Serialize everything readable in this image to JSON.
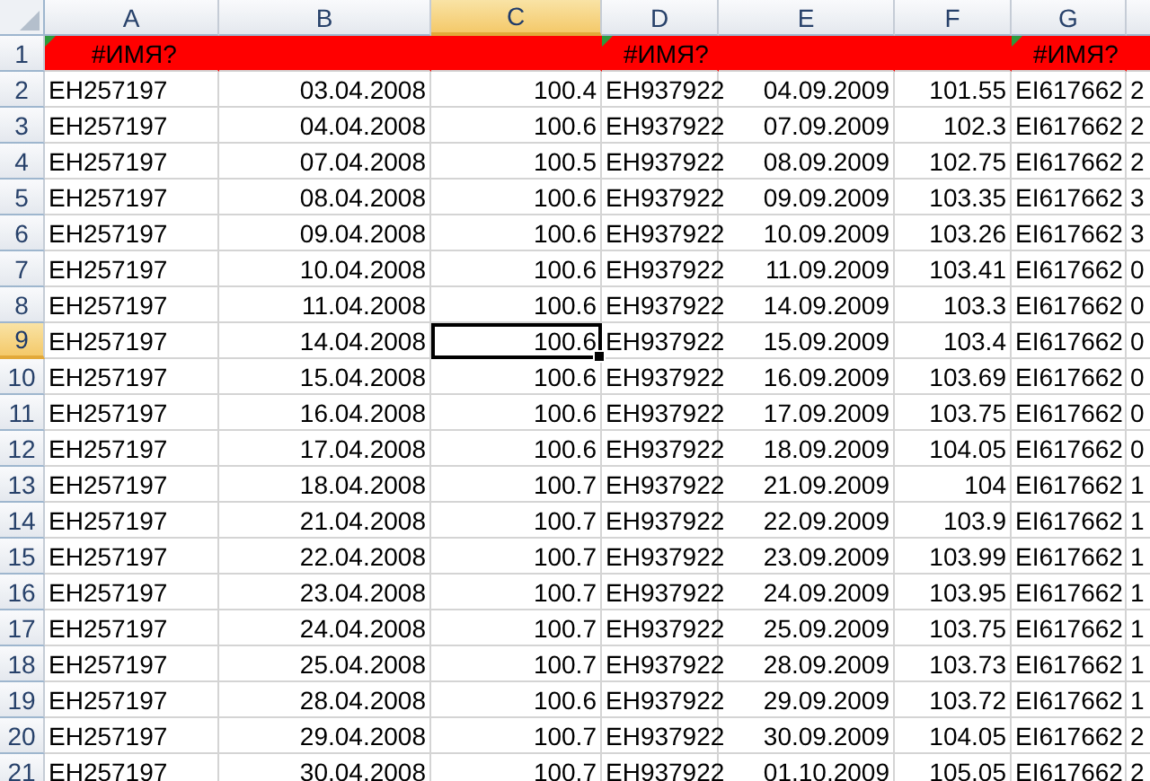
{
  "columns": [
    {
      "label": "A",
      "kind": "text",
      "selected": false
    },
    {
      "label": "B",
      "kind": "number",
      "selected": false
    },
    {
      "label": "C",
      "kind": "number",
      "selected": true
    },
    {
      "label": "D",
      "kind": "text",
      "selected": false
    },
    {
      "label": "E",
      "kind": "number",
      "selected": false
    },
    {
      "label": "F",
      "kind": "number",
      "selected": false
    },
    {
      "label": "G",
      "kind": "text",
      "selected": false
    },
    {
      "kind": "text",
      "selected": false
    }
  ],
  "error_row": {
    "number": "1",
    "selected": false,
    "cells": [
      "#ИМЯ?",
      null,
      null,
      "#ИМЯ?",
      null,
      null,
      "#ИМЯ?",
      null
    ]
  },
  "rows": [
    {
      "number": "2",
      "selected": false,
      "cells": [
        "EH257197",
        "03.04.2008",
        "100.4",
        "EH937922",
        "04.09.2009",
        "101.55",
        "EI617662",
        "2"
      ]
    },
    {
      "number": "3",
      "selected": false,
      "cells": [
        "EH257197",
        "04.04.2008",
        "100.6",
        "EH937922",
        "07.09.2009",
        "102.3",
        "EI617662",
        "2"
      ]
    },
    {
      "number": "4",
      "selected": false,
      "cells": [
        "EH257197",
        "07.04.2008",
        "100.5",
        "EH937922",
        "08.09.2009",
        "102.75",
        "EI617662",
        "2"
      ]
    },
    {
      "number": "5",
      "selected": false,
      "cells": [
        "EH257197",
        "08.04.2008",
        "100.6",
        "EH937922",
        "09.09.2009",
        "103.35",
        "EI617662",
        "3"
      ]
    },
    {
      "number": "6",
      "selected": false,
      "cells": [
        "EH257197",
        "09.04.2008",
        "100.6",
        "EH937922",
        "10.09.2009",
        "103.26",
        "EI617662",
        "3"
      ]
    },
    {
      "number": "7",
      "selected": false,
      "cells": [
        "EH257197",
        "10.04.2008",
        "100.6",
        "EH937922",
        "11.09.2009",
        "103.41",
        "EI617662",
        "0"
      ]
    },
    {
      "number": "8",
      "selected": false,
      "cells": [
        "EH257197",
        "11.04.2008",
        "100.6",
        "EH937922",
        "14.09.2009",
        "103.3",
        "EI617662",
        "0"
      ]
    },
    {
      "number": "9",
      "selected": true,
      "cells": [
        "EH257197",
        "14.04.2008",
        "100.6",
        "EH937922",
        "15.09.2009",
        "103.4",
        "EI617662",
        "0"
      ]
    },
    {
      "number": "10",
      "selected": false,
      "cells": [
        "EH257197",
        "15.04.2008",
        "100.6",
        "EH937922",
        "16.09.2009",
        "103.69",
        "EI617662",
        "0"
      ]
    },
    {
      "number": "11",
      "selected": false,
      "cells": [
        "EH257197",
        "16.04.2008",
        "100.6",
        "EH937922",
        "17.09.2009",
        "103.75",
        "EI617662",
        "0"
      ]
    },
    {
      "number": "12",
      "selected": false,
      "cells": [
        "EH257197",
        "17.04.2008",
        "100.6",
        "EH937922",
        "18.09.2009",
        "104.05",
        "EI617662",
        "0"
      ]
    },
    {
      "number": "13",
      "selected": false,
      "cells": [
        "EH257197",
        "18.04.2008",
        "100.7",
        "EH937922",
        "21.09.2009",
        "104",
        "EI617662",
        "1"
      ]
    },
    {
      "number": "14",
      "selected": false,
      "cells": [
        "EH257197",
        "21.04.2008",
        "100.7",
        "EH937922",
        "22.09.2009",
        "103.9",
        "EI617662",
        "1"
      ]
    },
    {
      "number": "15",
      "selected": false,
      "cells": [
        "EH257197",
        "22.04.2008",
        "100.7",
        "EH937922",
        "23.09.2009",
        "103.99",
        "EI617662",
        "1"
      ]
    },
    {
      "number": "16",
      "selected": false,
      "cells": [
        "EH257197",
        "23.04.2008",
        "100.7",
        "EH937922",
        "24.09.2009",
        "103.95",
        "EI617662",
        "1"
      ]
    },
    {
      "number": "17",
      "selected": false,
      "cells": [
        "EH257197",
        "24.04.2008",
        "100.7",
        "EH937922",
        "25.09.2009",
        "103.75",
        "EI617662",
        "1"
      ]
    },
    {
      "number": "18",
      "selected": false,
      "cells": [
        "EH257197",
        "25.04.2008",
        "100.7",
        "EH937922",
        "28.09.2009",
        "103.73",
        "EI617662",
        "1"
      ]
    },
    {
      "number": "19",
      "selected": false,
      "cells": [
        "EH257197",
        "28.04.2008",
        "100.6",
        "EH937922",
        "29.09.2009",
        "103.72",
        "EI617662",
        "1"
      ]
    },
    {
      "number": "20",
      "selected": false,
      "cells": [
        "EH257197",
        "29.04.2008",
        "100.7",
        "EH937922",
        "30.09.2009",
        "104.05",
        "EI617662",
        "2"
      ]
    },
    {
      "number": "21",
      "selected": false,
      "cells": [
        "EH257197",
        "30.04.2008",
        "100.7",
        "EH937922",
        "01.10.2009",
        "105.05",
        "EI617662",
        "2"
      ]
    }
  ]
}
